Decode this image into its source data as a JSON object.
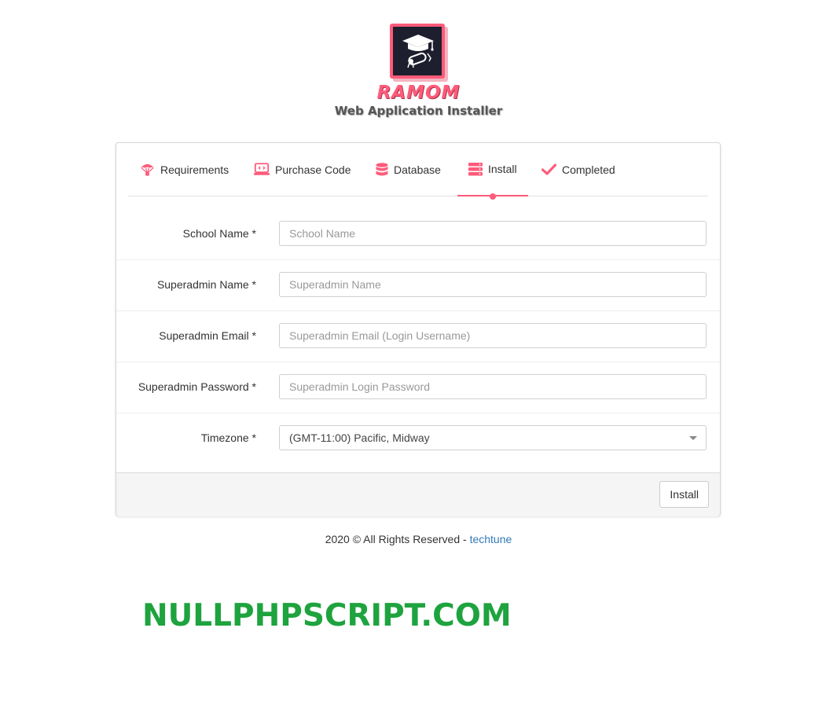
{
  "header": {
    "brand": "RAMOM",
    "subtitle": "Web Application Installer",
    "logo_icon": "graduation-cap-diploma-icon"
  },
  "tabs": [
    {
      "label": "Requirements",
      "icon": "parachute-icon",
      "active": false
    },
    {
      "label": "Purchase Code",
      "icon": "code-monitor-icon",
      "active": false
    },
    {
      "label": "Database",
      "icon": "database-icon",
      "active": false
    },
    {
      "label": "Install",
      "icon": "server-icon",
      "active": true
    },
    {
      "label": "Completed",
      "icon": "check-icon",
      "active": false
    }
  ],
  "form": {
    "school_name": {
      "label": "School Name *",
      "placeholder": "School Name",
      "value": ""
    },
    "superadmin_name": {
      "label": "Superadmin Name *",
      "placeholder": "Superadmin Name",
      "value": ""
    },
    "superadmin_email": {
      "label": "Superadmin Email *",
      "placeholder": "Superadmin Email (Login Username)",
      "value": ""
    },
    "superadmin_password": {
      "label": "Superadmin Password *",
      "placeholder": "Superadmin Login Password",
      "value": ""
    },
    "timezone": {
      "label": "Timezone *",
      "selected": "(GMT-11:00) Pacific, Midway"
    }
  },
  "actions": {
    "install_label": "Install"
  },
  "footer": {
    "copyright": "2020 © All Rights Reserved - ",
    "link_text": "techtune"
  },
  "watermark": "NULLPHPSCRIPT.COM",
  "colors": {
    "accent": "#ff5b7a",
    "link": "#337ab7",
    "watermark": "#1ea33f",
    "logo_bg": "#1d1f2e"
  }
}
